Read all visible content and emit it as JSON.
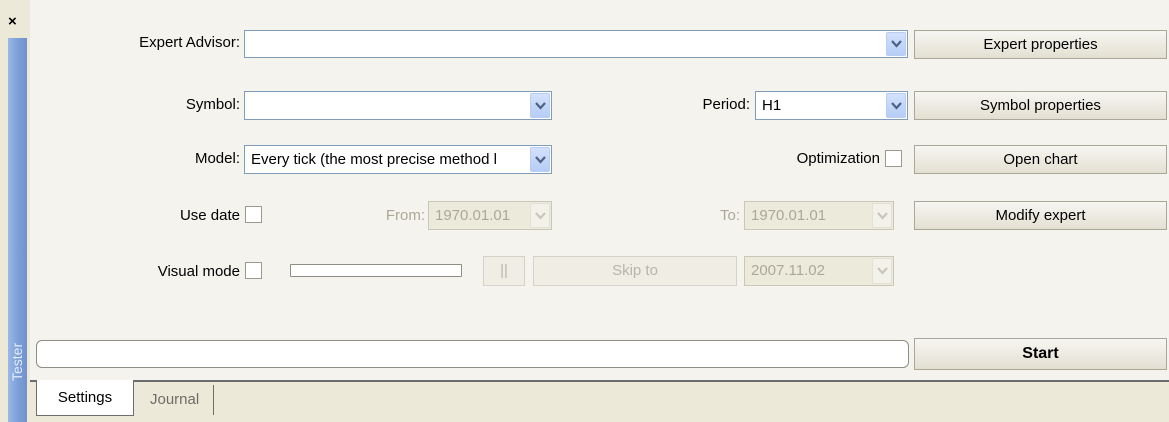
{
  "window": {
    "side_label": "Tester",
    "close_glyph": "×"
  },
  "form": {
    "expert_advisor_label": "Expert Advisor:",
    "expert_advisor_value": "",
    "symbol_label": "Symbol:",
    "symbol_value": "",
    "period_label": "Period:",
    "period_value": "H1",
    "model_label": "Model:",
    "model_value": "Every tick (the most precise method l",
    "optimization_label": "Optimization",
    "use_date_label": "Use date",
    "from_label": "From:",
    "from_value": "1970.01.01",
    "to_label": "To:",
    "to_value": "1970.01.01",
    "visual_mode_label": "Visual mode",
    "pause_glyph": "||",
    "skip_to_label": "Skip to",
    "skip_date_value": "2007.11.02"
  },
  "buttons": {
    "expert_properties": "Expert properties",
    "symbol_properties": "Symbol properties",
    "open_chart": "Open chart",
    "modify_expert": "Modify expert",
    "start": "Start"
  },
  "checkboxes": {
    "optimization": false,
    "use_date": false,
    "visual_mode": false
  },
  "progress": {
    "main_progress": 0,
    "visual_speed": 0
  },
  "tabs": {
    "settings": "Settings",
    "journal": "Journal"
  }
}
